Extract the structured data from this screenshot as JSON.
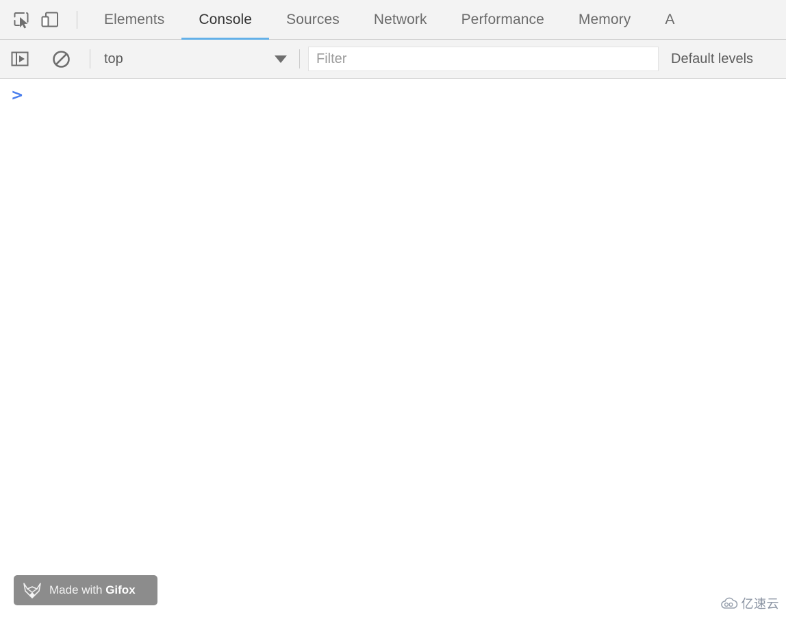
{
  "devtools": {
    "toolbar_icons": [
      {
        "name": "inspect-element-icon",
        "label": "Inspect element"
      },
      {
        "name": "device-toolbar-icon",
        "label": "Toggle device toolbar"
      }
    ],
    "tabs": [
      {
        "label": "Elements",
        "active": false
      },
      {
        "label": "Console",
        "active": true
      },
      {
        "label": "Sources",
        "active": false
      },
      {
        "label": "Network",
        "active": false
      },
      {
        "label": "Performance",
        "active": false
      },
      {
        "label": "Memory",
        "active": false
      },
      {
        "label": "A",
        "active": false
      }
    ],
    "active_tab": "Console",
    "accent_color": "#63b0e8"
  },
  "console_toolbar": {
    "sidebar_toggle": {
      "name": "console-sidebar-toggle-icon",
      "label": "Show console sidebar"
    },
    "clear_console": {
      "name": "clear-console-icon",
      "label": "Clear console"
    },
    "context": {
      "selected": "top",
      "chevron": "chevron-down-icon"
    },
    "filter": {
      "placeholder": "Filter",
      "value": ""
    },
    "levels": {
      "label": "Default levels"
    }
  },
  "console_body": {
    "prompt_symbol": ">",
    "prompt_value": "",
    "messages": []
  },
  "gifox_badge": {
    "prefix": "Made with ",
    "brand": "Gifox",
    "logo": "fox-head-icon",
    "background": "#8c8c8c"
  },
  "watermark": {
    "text": "亿速云",
    "logo": "cloud-icon",
    "color": "#8b94a3"
  }
}
